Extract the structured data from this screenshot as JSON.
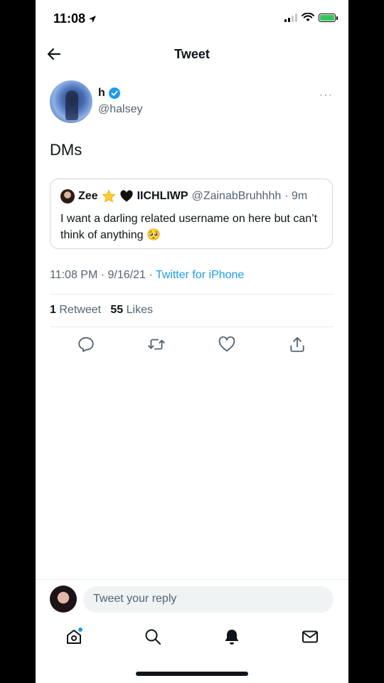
{
  "status_bar": {
    "time": "11:08"
  },
  "header": {
    "title": "Tweet"
  },
  "tweet": {
    "name": "h",
    "handle": "@halsey",
    "text": "DMs",
    "more": "···",
    "timestamp": "11:08 PM · 9/16/21 · ",
    "source": "Twitter for iPhone"
  },
  "quote": {
    "name": "Zee",
    "name_extra": "IICHLIWP",
    "handle": "@ZainabBruhhhh",
    "time": "· 9m",
    "text": "I want a darling related username on here but can’t think of anything 🥺"
  },
  "stats": {
    "retweets_count": "1",
    "retweets_label": "Retweet",
    "likes_count": "55",
    "likes_label": "Likes"
  },
  "composer": {
    "placeholder": "Tweet your reply"
  },
  "colors": {
    "accent": "#1d9bf0",
    "text": "#0f1419",
    "muted": "#536471"
  },
  "icons": {
    "back": "arrow-left-icon",
    "verified": "verified-badge-icon",
    "reply": "reply-icon",
    "retweet": "retweet-icon",
    "like": "heart-icon",
    "share": "share-icon",
    "home": "home-icon",
    "search": "search-icon",
    "notifications": "bell-icon",
    "messages": "mail-icon"
  }
}
